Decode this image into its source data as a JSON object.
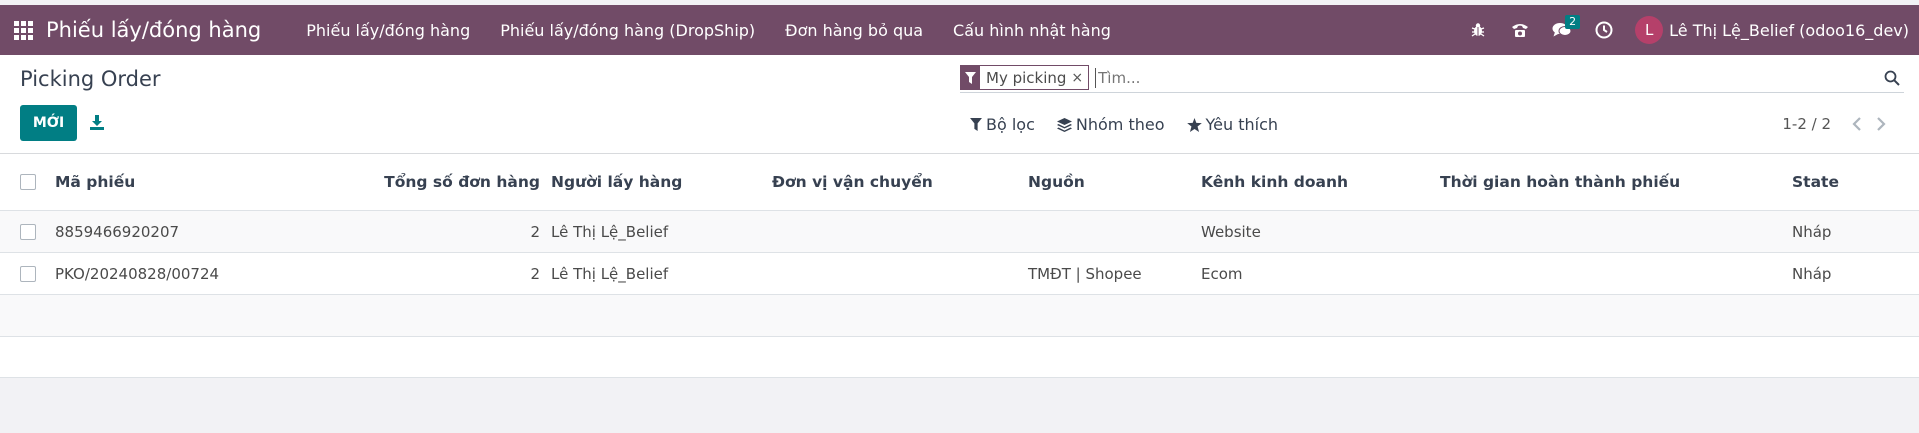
{
  "navbar": {
    "app_name": "Phiếu lấy/đóng hàng",
    "menu": [
      "Phiếu lấy/đóng hàng",
      "Phiếu lấy/đóng hàng (DropShip)",
      "Đơn hàng bỏ qua",
      "Cấu hình nhật hàng"
    ],
    "messages_badge": "2",
    "user_initial": "L",
    "user_name": "Lê Thị Lệ_Belief (odoo16_dev)"
  },
  "control": {
    "title": "Picking Order",
    "new_label": "MỚI",
    "search": {
      "facet_value": "My picking",
      "facet_remove": "×",
      "placeholder": "Tìm..."
    },
    "filters": {
      "filter_label": "Bộ lọc",
      "group_label": "Nhóm theo",
      "favorite_label": "Yêu thích"
    },
    "pager_value": "1-2 / 2"
  },
  "table": {
    "headers": [
      "Mã phiếu",
      "Tổng số đơn hàng",
      "Người lấy hàng",
      "Đơn vị vận chuyển",
      "Nguồn",
      "Kênh kinh doanh",
      "Thời gian hoàn thành phiếu",
      "State"
    ],
    "rows": [
      [
        "8859466920207",
        "2",
        "Lê Thị Lệ_Belief",
        "",
        "",
        "Website",
        "",
        "Nháp"
      ],
      [
        "PKO/20240828/00724",
        "2",
        "Lê Thị Lệ_Belief",
        "",
        "TMĐT | Shopee",
        "Ecom",
        "",
        "Nháp"
      ]
    ]
  },
  "colors": {
    "brand": "#714b67",
    "primary_button": "#017e84",
    "avatar": "#b5406a"
  },
  "icons": [
    "apps-grid-icon",
    "bug-icon",
    "phone-icon",
    "chat-icon",
    "clock-icon",
    "download-icon",
    "filter-icon",
    "search-icon",
    "layers-icon",
    "star-icon",
    "chevron-left-icon",
    "chevron-right-icon"
  ]
}
